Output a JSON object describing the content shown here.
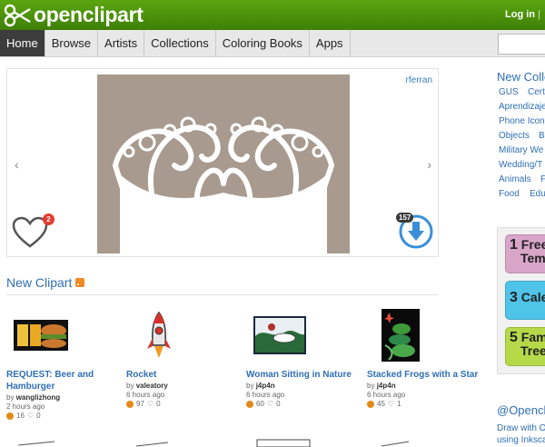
{
  "header": {
    "logo_text": "openclipart",
    "login_label": "Log in",
    "separator": "|"
  },
  "nav": {
    "items": [
      "Home",
      "Browse",
      "Artists",
      "Collections",
      "Coloring Books",
      "Apps"
    ],
    "active": "Home"
  },
  "search": {
    "placeholder": ""
  },
  "carousel": {
    "author": "rferran",
    "prev_arrow": "‹",
    "next_arrow": "›",
    "favorites_count": "2",
    "downloads_count": "157",
    "image_bg": "#a89a8f"
  },
  "new_clipart": {
    "title": "New Clipart",
    "items": [
      {
        "title": "REQUEST: Beer and Hamburger",
        "by_label": "by",
        "author": "wanglizhong",
        "time": "2 hours ago",
        "views": "16",
        "likes": "0"
      },
      {
        "title": "Rocket",
        "by_label": "by",
        "author": "valeatory",
        "time": "6 hours ago",
        "views": "97",
        "likes": "0"
      },
      {
        "title": "Woman Sitting in Nature",
        "by_label": "by",
        "author": "j4p4n",
        "time": "6 hours ago",
        "views": "60",
        "likes": "0"
      },
      {
        "title": "Stacked Frogs with a Star",
        "by_label": "by",
        "author": "j4p4n",
        "time": "6 hours ago",
        "views": "45",
        "likes": "1"
      }
    ]
  },
  "sidebar": {
    "new_collections_title": "New Colle",
    "tags": [
      "GUS",
      "Cert",
      "Aprendizaje",
      "Phone Icon",
      "Objects",
      "B",
      "Military We",
      "Wedding/T",
      "Animals",
      "F",
      "Food",
      "Edu"
    ],
    "promo": [
      {
        "num": "1",
        "label_1": "Free",
        "label_2": "Temp",
        "color": "#d9a6c9"
      },
      {
        "num": "3",
        "label_1": "Cale",
        "label_2": "",
        "color": "#4fc3e8"
      },
      {
        "num": "5",
        "label_1": "Fam",
        "label_2": "Tree",
        "color": "#b6d94a"
      }
    ],
    "twitter_title": "@Opencl",
    "twitter_text_1": "Draw with O",
    "twitter_text_2": "using Inkscap"
  },
  "colors": {
    "header_green": "#4a8f0a",
    "link_blue": "#2f6fb4",
    "nav_active": "#3c3c3c",
    "badge_red": "#e23b2e",
    "download_blue": "#3a8fd8"
  }
}
